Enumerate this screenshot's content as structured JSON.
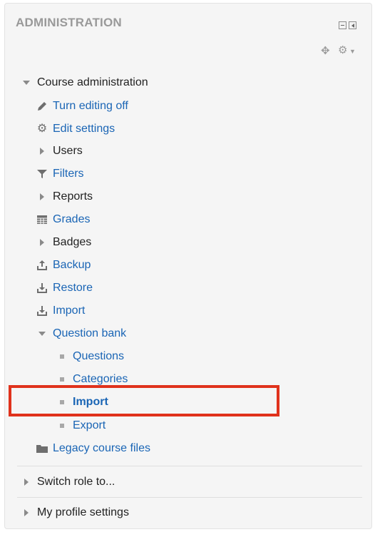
{
  "block": {
    "title": "ADMINISTRATION"
  },
  "course_admin": {
    "label": "Course administration",
    "items": {
      "turn_editing_off": "Turn editing off",
      "edit_settings": "Edit settings",
      "users": "Users",
      "filters": "Filters",
      "reports": "Reports",
      "grades": "Grades",
      "badges": "Badges",
      "backup": "Backup",
      "restore": "Restore",
      "import": "Import",
      "question_bank": "Question bank",
      "qb_questions": "Questions",
      "qb_categories": "Categories",
      "qb_import": "Import",
      "qb_export": "Export",
      "legacy_files": "Legacy course files"
    }
  },
  "switch_role": "Switch role to...",
  "profile_settings": "My profile settings",
  "colors": {
    "link": "#1a65b5",
    "highlight": "#e0321c",
    "header": "#999999"
  },
  "icons": [
    "pencil-icon",
    "gear-icon",
    "filter-icon",
    "grid-icon",
    "upload-icon",
    "download-icon",
    "folder-icon",
    "move-icon",
    "menu-gear-icon"
  ]
}
